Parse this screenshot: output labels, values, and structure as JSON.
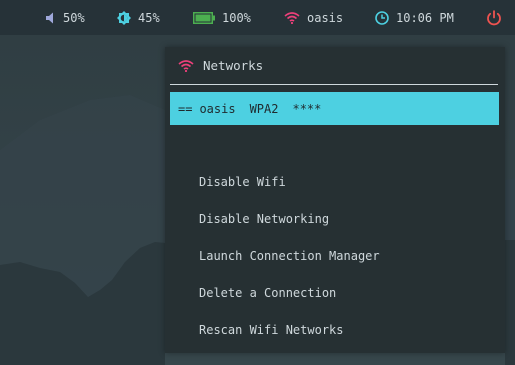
{
  "topbar": {
    "volume": {
      "icon": "speaker-icon",
      "value": "50%"
    },
    "brightness": {
      "icon": "brightness-icon",
      "value": "45%"
    },
    "battery": {
      "icon": "battery-icon",
      "value": "100%",
      "level": 1.0
    },
    "wifi": {
      "icon": "wifi-icon",
      "ssid": "oasis"
    },
    "clock": {
      "icon": "clock-icon",
      "time": "10:06 PM"
    },
    "power": {
      "icon": "power-icon"
    }
  },
  "popup": {
    "title": "Networks",
    "icon": "wifi-icon",
    "networks": [
      {
        "marker": "==",
        "ssid": "oasis",
        "security": "WPA2",
        "signal": "****",
        "selected": true
      }
    ],
    "menu": [
      {
        "label": "Disable Wifi"
      },
      {
        "label": "Disable Networking"
      },
      {
        "label": "Launch Connection Manager"
      },
      {
        "label": "Delete a Connection"
      },
      {
        "label": "Rescan Wifi Networks"
      }
    ]
  },
  "colors": {
    "bar_bg": "#263238",
    "popup_bg": "#263033",
    "accent_cyan": "#4dd0e1",
    "battery_green": "#4caf50",
    "wifi_pink": "#ec407a",
    "volume_purple": "#9fa8da",
    "power_red": "#ef5350",
    "text": "#cfd8dc"
  }
}
